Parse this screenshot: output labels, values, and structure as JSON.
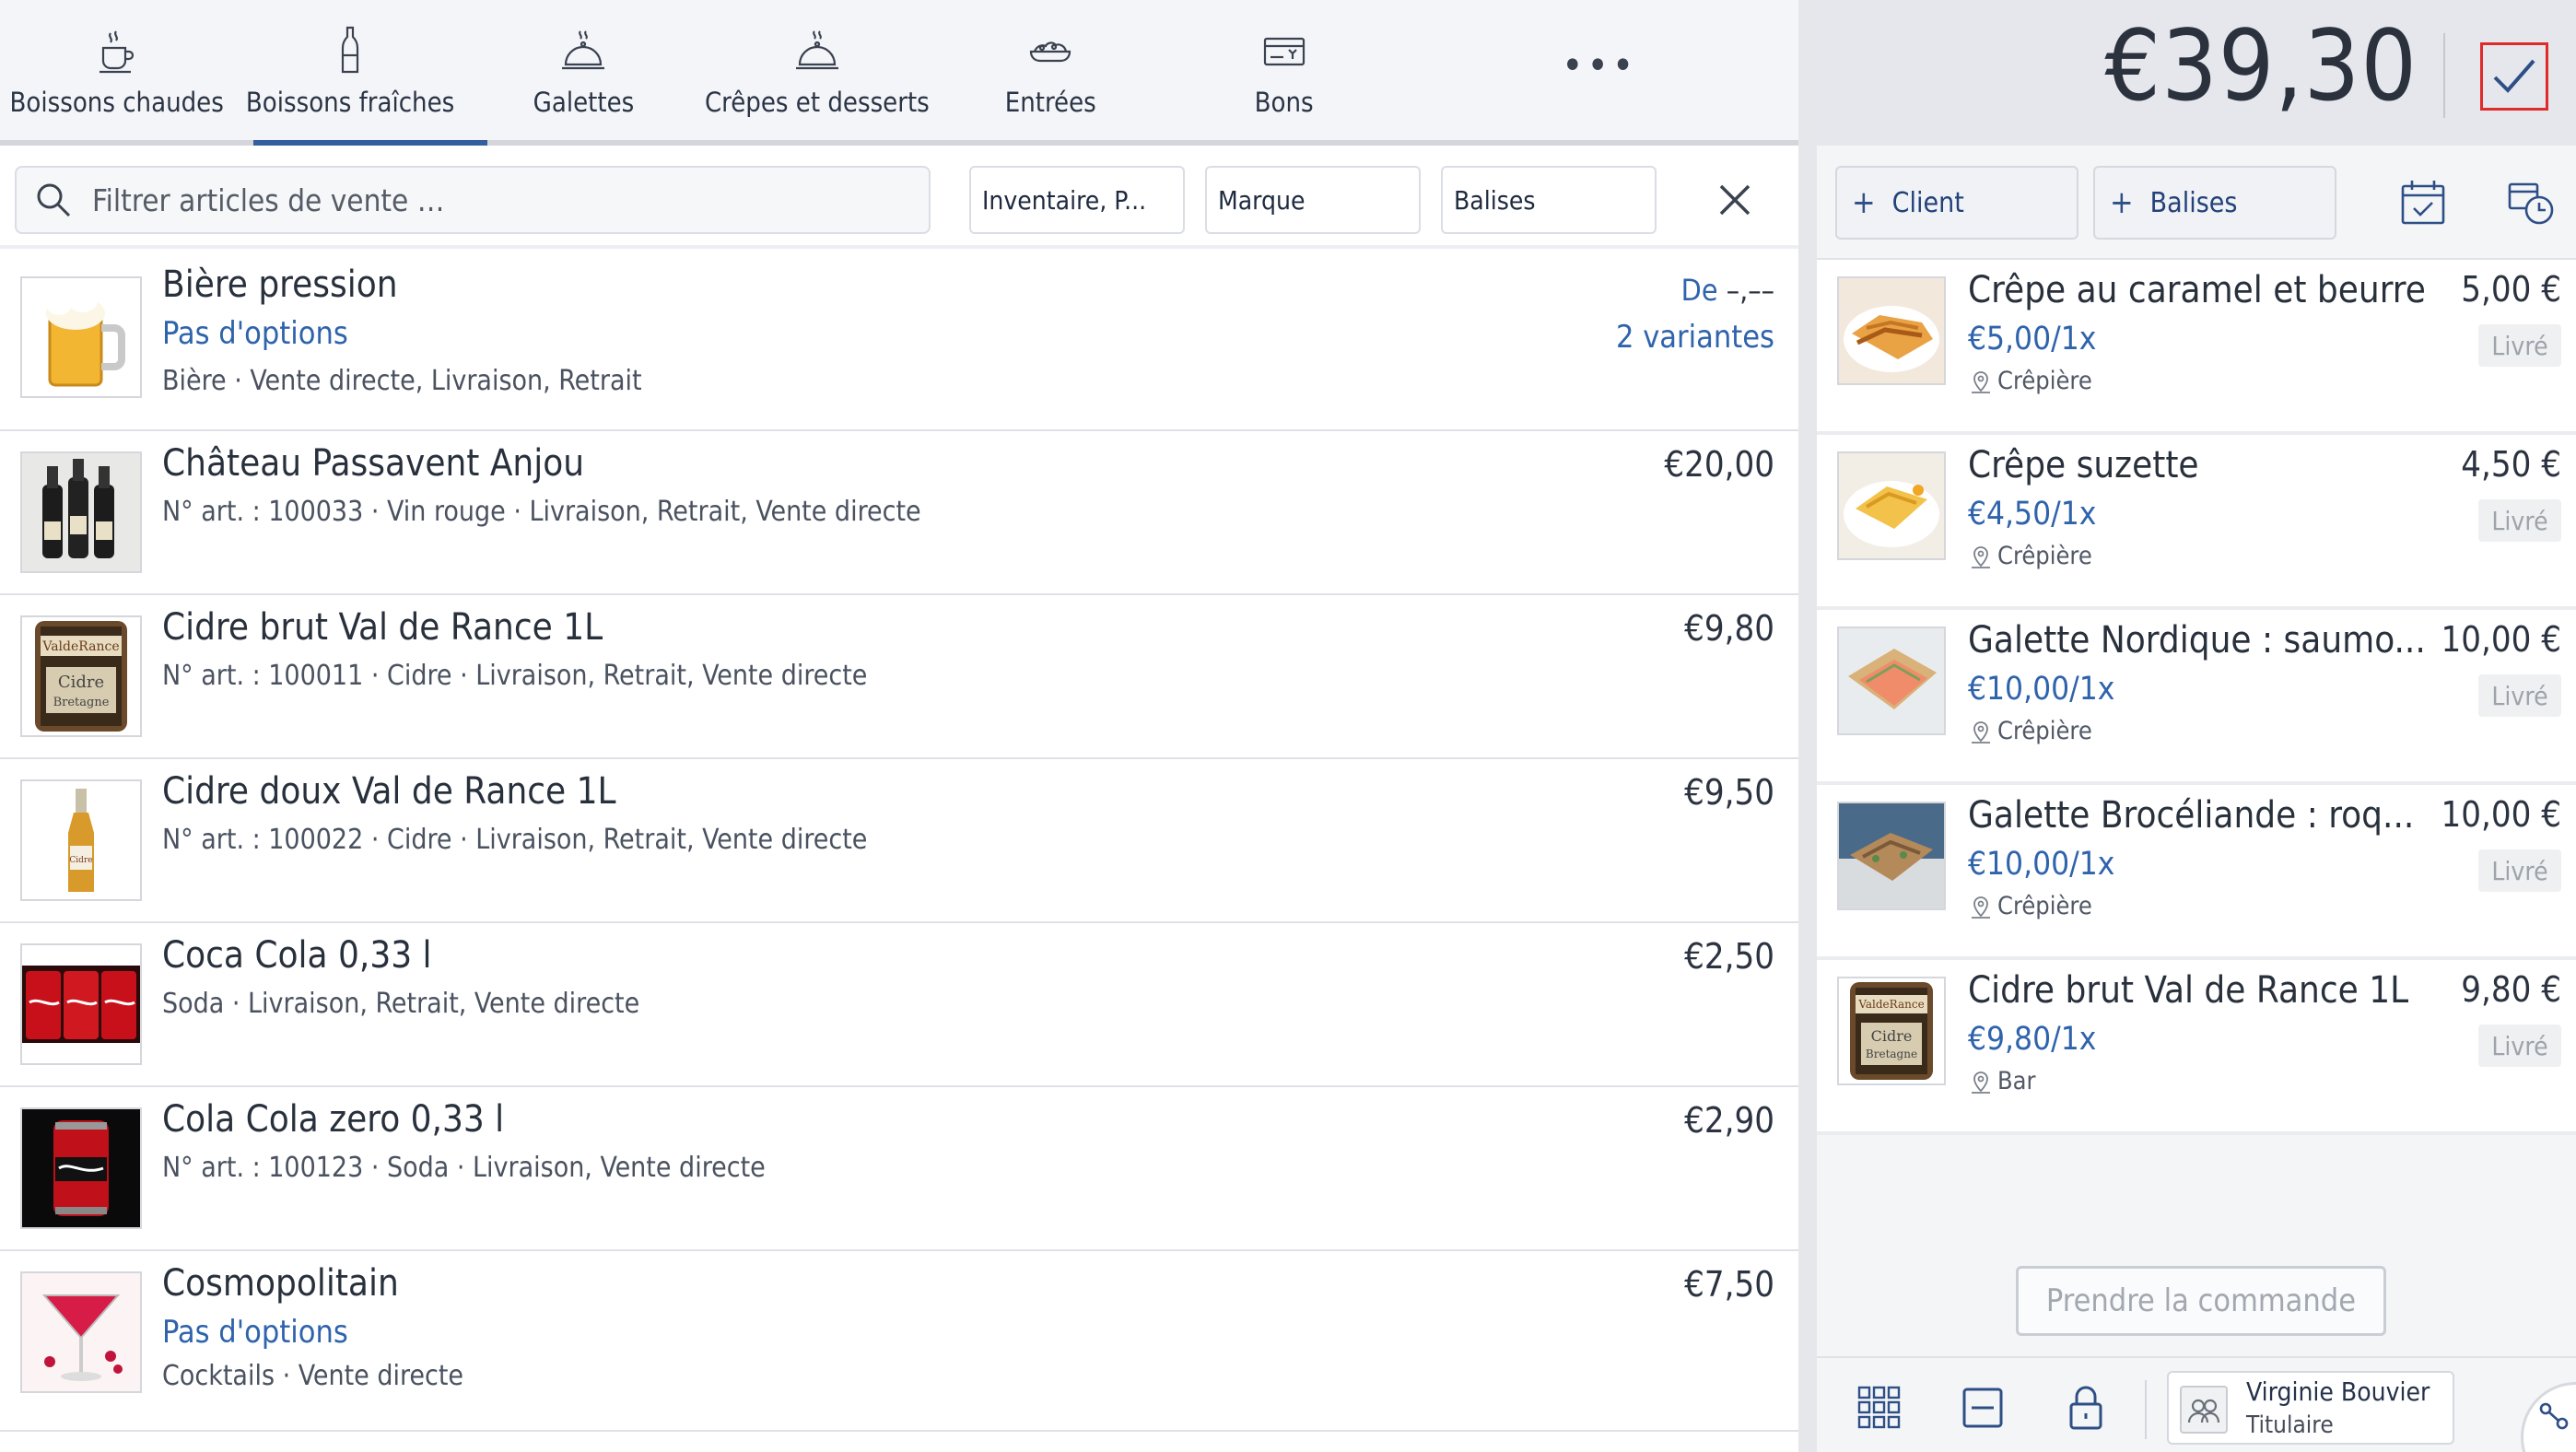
{
  "categories": [
    {
      "label": "Boissons chaudes",
      "icon": "coffee-cup-icon"
    },
    {
      "label": "Boissons fraîches",
      "icon": "bottle-icon",
      "active": true
    },
    {
      "label": "Galettes",
      "icon": "cloche-icon"
    },
    {
      "label": "Crêpes et desserts",
      "icon": "cloche-icon"
    },
    {
      "label": "Entrées",
      "icon": "salad-bowl-icon"
    },
    {
      "label": "Bons",
      "icon": "voucher-icon"
    }
  ],
  "more_label": "•••",
  "filter": {
    "search_placeholder": "Filtrer articles de vente …",
    "inventory_label": "Inventaire, P...",
    "brand_label": "Marque",
    "tags_label": "Balises"
  },
  "products": [
    {
      "name": "Bière pression",
      "options": "Pas d'options",
      "meta": "Bière · Vente directe, Livraison, Retrait",
      "price_prefix": "De",
      "price": "–,––",
      "variants": "2 variantes",
      "thumb": "beer"
    },
    {
      "name": "Château Passavent Anjou",
      "meta": "N° art. : 100033 · Vin rouge · Livraison, Retrait, Vente directe",
      "price": "€20,00",
      "thumb": "wine"
    },
    {
      "name": "Cidre brut Val de Rance 1L",
      "meta": "N° art. : 100011 · Cidre · Livraison, Retrait, Vente directe",
      "price": "€9,80",
      "thumb": "cider-brut"
    },
    {
      "name": "Cidre doux Val de Rance 1L",
      "meta": "N° art. : 100022 · Cidre · Livraison, Retrait, Vente directe",
      "price": "€9,50",
      "thumb": "cider-doux"
    },
    {
      "name": "Coca Cola 0,33 l",
      "meta": "Soda · Livraison, Retrait, Vente directe",
      "price": "€2,50",
      "thumb": "coca"
    },
    {
      "name": "Cola Cola zero 0,33 l",
      "meta": "N° art. : 100123 · Soda · Livraison, Vente directe",
      "price": "€2,90",
      "thumb": "coca-can"
    },
    {
      "name": "Cosmopolitain",
      "options": "Pas d'options",
      "meta": "Cocktails · Vente directe",
      "price": "€7,50",
      "thumb": "cocktail"
    }
  ],
  "order": {
    "total": "€39,30",
    "client_label": "Client",
    "tags_label": "Balises",
    "items": [
      {
        "name": "Crêpe au caramel et beurre...",
        "price": "5,00 €",
        "unit": "€5,00/1x",
        "station": "Crêpière",
        "status": "Livré",
        "thumb": "crepe-caramel"
      },
      {
        "name": "Crêpe suzette",
        "price": "4,50 €",
        "unit": "€4,50/1x",
        "station": "Crêpière",
        "status": "Livré",
        "thumb": "crepe-suzette"
      },
      {
        "name": "Galette Nordique : saumo...",
        "price": "10,00 €",
        "unit": "€10,00/1x",
        "station": "Crêpière",
        "status": "Livré",
        "thumb": "galette-nordique"
      },
      {
        "name": "Galette Brocéliande : roq...",
        "price": "10,00 €",
        "unit": "€10,00/1x",
        "station": "Crêpière",
        "status": "Livré",
        "thumb": "galette-broceliande"
      },
      {
        "name": "Cidre brut Val de Rance 1L",
        "price": "9,80 €",
        "unit": "€9,80/1x",
        "station": "Bar",
        "status": "Livré",
        "thumb": "cider-brut"
      }
    ],
    "take_order_label": "Prendre la commande"
  },
  "user": {
    "name": "Virginie Bouvier",
    "role": "Titulaire"
  },
  "colors": {
    "accent": "#2f63ac",
    "confirm_border": "#e02b2b",
    "tab_underline": "#355e9e"
  }
}
